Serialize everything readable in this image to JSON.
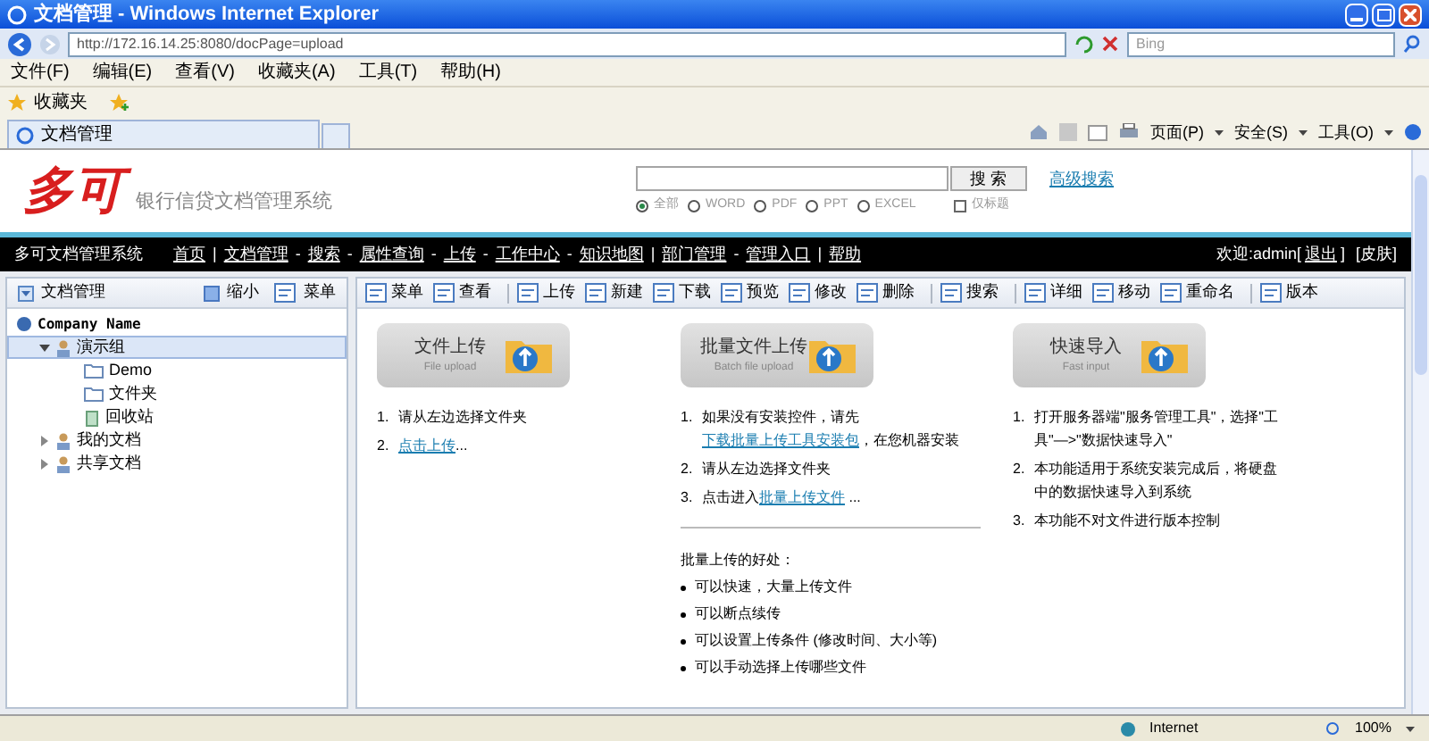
{
  "window": {
    "title": "文档管理 - Windows Internet Explorer"
  },
  "address_bar": {
    "url": "http://172.16.14.25:8080/docPage=upload",
    "search_placeholder": "Bing"
  },
  "menu": [
    "文件(F)",
    "编辑(E)",
    "查看(V)",
    "收藏夹(A)",
    "工具(T)",
    "帮助(H)"
  ],
  "favorites_bar": {
    "label": "收藏夹"
  },
  "tabs": [
    {
      "label": "文档管理",
      "selected": true
    }
  ],
  "command_bar": [
    "页面(P)",
    "安全(S)",
    "工具(O)"
  ],
  "header": {
    "logo": "多可",
    "subtitle": "银行信贷文档管理系统",
    "search_button": "搜 索",
    "advanced_search": "高级搜索",
    "filters": [
      {
        "label": "全部",
        "selected": true
      },
      {
        "label": "WORD",
        "selected": false
      },
      {
        "label": "PDF",
        "selected": false
      },
      {
        "label": "PPT",
        "selected": false
      },
      {
        "label": "EXCEL",
        "selected": false
      }
    ],
    "title_only": {
      "label": "仅标题",
      "checked": false
    }
  },
  "nav": {
    "brand": "多可文档管理系统",
    "items": [
      {
        "kind": "link",
        "text": "首页"
      },
      {
        "kind": "separator",
        "text": "|"
      },
      {
        "kind": "link",
        "text": "文档管理"
      },
      {
        "kind": "separator",
        "text": "-"
      },
      {
        "kind": "link",
        "text": "搜索"
      },
      {
        "kind": "separator",
        "text": "-"
      },
      {
        "kind": "link",
        "text": "属性查询"
      },
      {
        "kind": "separator",
        "text": "-"
      },
      {
        "kind": "link",
        "text": "上传"
      },
      {
        "kind": "separator",
        "text": "-"
      },
      {
        "kind": "link",
        "text": "工作中心"
      },
      {
        "kind": "separator",
        "text": "-"
      },
      {
        "kind": "link",
        "text": "知识地图"
      },
      {
        "kind": "separator",
        "text": "|"
      },
      {
        "kind": "link",
        "text": "部门管理"
      },
      {
        "kind": "separator",
        "text": "-"
      },
      {
        "kind": "link",
        "text": "管理入口"
      },
      {
        "kind": "separator",
        "text": "|"
      },
      {
        "kind": "link",
        "text": "帮助"
      }
    ],
    "welcome": "欢迎:admin[",
    "logout": "退出",
    "close_bracket": "]",
    "skin": "[皮肤]"
  },
  "sidebar": {
    "title": "文档管理",
    "shrink": "缩小",
    "menu": "菜单",
    "tree": [
      {
        "label": "Company Name",
        "kind": "root",
        "selected": false,
        "children": [
          {
            "label": "演示组",
            "kind": "group",
            "expanded": true,
            "selected": true,
            "children": [
              {
                "label": "Demo",
                "kind": "folder",
                "selected": false
              },
              {
                "label": "文件夹",
                "kind": "folder",
                "selected": false
              },
              {
                "label": "回收站",
                "kind": "recycle",
                "selected": false
              }
            ]
          },
          {
            "label": "我的文档",
            "kind": "group",
            "expanded": false,
            "selected": false
          },
          {
            "label": "共享文档",
            "kind": "group",
            "expanded": false,
            "selected": false
          }
        ]
      }
    ]
  },
  "toolbar": [
    [
      "菜单",
      "查看"
    ],
    [
      "上传",
      "新建",
      "下载",
      "预览",
      "修改",
      "删除"
    ],
    [
      "搜索"
    ],
    [
      "详细",
      "移动",
      "重命名"
    ],
    [
      "版本"
    ]
  ],
  "panels": [
    {
      "title": "文件上传",
      "subtitle": "File upload",
      "steps": [
        {
          "marker": "1.",
          "before": "请从左边选择文件夹"
        },
        {
          "marker": "2.",
          "link": "点击上传",
          "after": "..."
        }
      ]
    },
    {
      "title": "批量文件上传",
      "subtitle": "Batch file upload",
      "steps": [
        {
          "marker": "1.",
          "before": "如果没有安装控件，请先",
          "link": "下载批量上传工具安装包",
          "after": "，在您机器安装"
        },
        {
          "marker": "2.",
          "before": "请从左边选择文件夹"
        },
        {
          "marker": "3.",
          "before": "点击进入",
          "link": "批量上传文件",
          "after": " ..."
        }
      ],
      "benefits_title": "批量上传的好处：",
      "benefits": [
        "可以快速，大量上传文件",
        "可以断点续传",
        "可以设置上传条件 (修改时间、大小等)",
        "可以手动选择上传哪些文件"
      ]
    },
    {
      "title": "快速导入",
      "subtitle": "Fast input",
      "steps": [
        {
          "marker": "1.",
          "before": "打开服务器端\"服务管理工具\"，选择\"工具\"—>\"数据快速导入\""
        },
        {
          "marker": "2.",
          "before": "本功能适用于系统安装完成后，将硬盘中的数据快速导入到系统"
        },
        {
          "marker": "3.",
          "before": "本功能不对文件进行版本控制"
        }
      ]
    }
  ],
  "status_bar": {
    "zone": "Internet",
    "zoom": "100%"
  }
}
